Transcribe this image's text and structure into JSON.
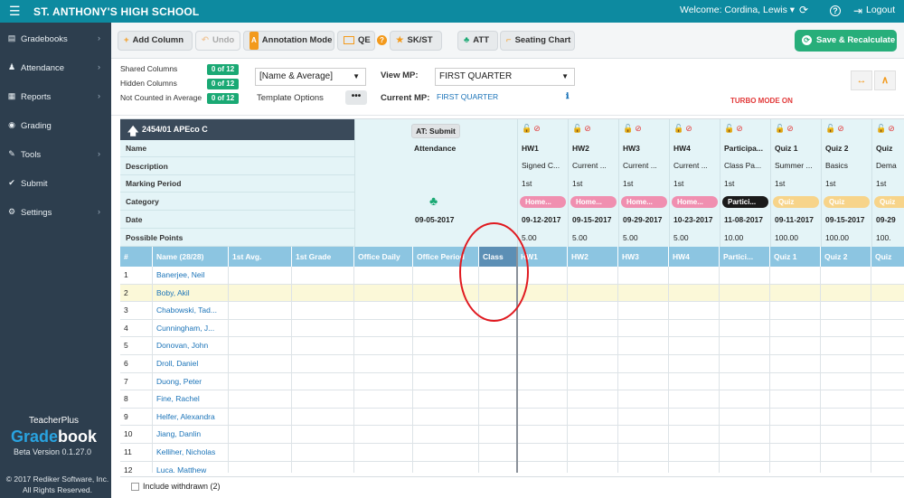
{
  "topbar": {
    "school": "ST. ANTHONY'S HIGH SCHOOL",
    "welcome": "Welcome: Cordina, Lewis",
    "logout": "Logout",
    "welcome_caret": "▾",
    "refresh_icon": "⟳",
    "help_icon": "?",
    "logout_icon": "⇥"
  },
  "sidebar": {
    "items": [
      {
        "label": "Gradebooks",
        "icon": "book-icon",
        "chevron": true
      },
      {
        "label": "Attendance",
        "icon": "users-icon",
        "chevron": true
      },
      {
        "label": "Reports",
        "icon": "report-icon",
        "chevron": true
      },
      {
        "label": "Grading",
        "icon": "grading-icon",
        "chevron": false
      },
      {
        "label": "Tools",
        "icon": "wrench-icon",
        "chevron": true
      },
      {
        "label": "Submit",
        "icon": "check-circle-icon",
        "chevron": false
      },
      {
        "label": "Settings",
        "icon": "gear-icon",
        "chevron": true
      }
    ],
    "brand_top": "TeacherPlus",
    "brand_a": "Grade",
    "brand_b": "book",
    "version": "Beta Version 0.1.27.0",
    "copyright_1": "© 2017 Rediker Software, Inc.",
    "copyright_2": "All Rights Reserved."
  },
  "toolbar": {
    "add_column": "Add Column",
    "undo": "Undo",
    "annotation_mode": "Annotation Mode",
    "qe": "QE",
    "sk_st": "SK/ST",
    "att": "ATT",
    "seating_chart": "Seating Chart",
    "save_recalculate": "Save & Recalculate"
  },
  "settings": {
    "shared_columns": "Shared Columns",
    "shared_badge": "0 of 12",
    "hidden_columns": "Hidden Columns",
    "hidden_badge": "0 of 12",
    "not_counted": "Not Counted in Average",
    "not_counted_badge": "0 of 12",
    "name_display": "[Name & Average]",
    "template_options": "Template Options",
    "template_dots": "•••",
    "view_mp_label": "View MP:",
    "view_mp_value": "FIRST QUARTER",
    "current_mp_label": "Current MP:",
    "current_mp_value": "FIRST QUARTER",
    "turbo_mode": "TURBO MODE ON"
  },
  "grid": {
    "class_name": "2454/01 APEco C",
    "labels": [
      "Name",
      "Description",
      "Marking Period",
      "Category",
      "Date",
      "Possible Points"
    ],
    "attendance": {
      "submit_label": "AT: Submit",
      "label": "Attendance",
      "date": "09-05-2017"
    },
    "assignments": [
      {
        "name": "HW1",
        "description": "Signed C...",
        "mp": "1st",
        "category": "Home...",
        "cat_color": "#f08fb0",
        "date": "09-12-2017",
        "points": "5.00"
      },
      {
        "name": "HW2",
        "description": "Current ...",
        "mp": "1st",
        "category": "Home...",
        "cat_color": "#f08fb0",
        "date": "09-15-2017",
        "points": "5.00"
      },
      {
        "name": "HW3",
        "description": "Current ...",
        "mp": "1st",
        "category": "Home...",
        "cat_color": "#f08fb0",
        "date": "09-29-2017",
        "points": "5.00"
      },
      {
        "name": "HW4",
        "description": "Current ...",
        "mp": "1st",
        "category": "Home...",
        "cat_color": "#f08fb0",
        "date": "10-23-2017",
        "points": "5.00"
      },
      {
        "name": "Participa...",
        "description": "Class Pa...",
        "mp": "1st",
        "category": "Partici...",
        "cat_color": "#1a1a1a",
        "date": "11-08-2017",
        "points": "10.00"
      },
      {
        "name": "Quiz 1",
        "description": "Summer ...",
        "mp": "1st",
        "category": "Quiz",
        "cat_color": "#f7d48a",
        "date": "09-11-2017",
        "points": "100.00"
      },
      {
        "name": "Quiz 2",
        "description": "Basics",
        "mp": "1st",
        "category": "Quiz",
        "cat_color": "#f7d48a",
        "date": "09-15-2017",
        "points": "100.00"
      },
      {
        "name": "Quiz",
        "description": "Dema",
        "mp": "1st",
        "category": "Quiz",
        "cat_color": "#f7d48a",
        "date": "09-29",
        "points": "100."
      }
    ],
    "header_columns": [
      "#",
      "Name (28/28)",
      "1st Avg.",
      "1st Grade",
      "Office Daily",
      "Office Period",
      "Class",
      "HW1",
      "HW2",
      "HW3",
      "HW4",
      "Partici...",
      "Quiz 1",
      "Quiz 2",
      "Quiz"
    ],
    "students": [
      {
        "num": "1",
        "name": "Banerjee, Neil"
      },
      {
        "num": "2",
        "name": "Boby, Akil"
      },
      {
        "num": "3",
        "name": "Chabowski, Tad..."
      },
      {
        "num": "4",
        "name": "Cunningham, J..."
      },
      {
        "num": "5",
        "name": "Donovan, John"
      },
      {
        "num": "6",
        "name": "Droll, Daniel"
      },
      {
        "num": "7",
        "name": "Duong, Peter"
      },
      {
        "num": "8",
        "name": "Fine, Rachel"
      },
      {
        "num": "9",
        "name": "Helfer, Alexandra"
      },
      {
        "num": "10",
        "name": "Jiang, Danlin"
      },
      {
        "num": "11",
        "name": "Kelliher, Nicholas"
      },
      {
        "num": "12",
        "name": "Luca, Matthew"
      }
    ],
    "selected_row": 1,
    "include_withdrawn": "Include withdrawn (2)"
  }
}
